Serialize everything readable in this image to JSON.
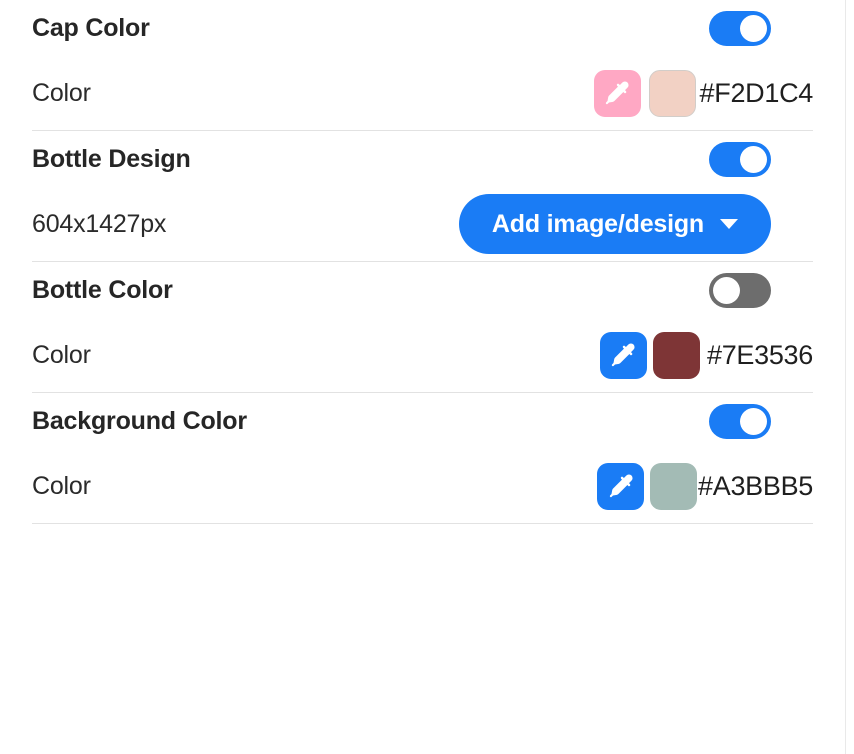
{
  "panel": {
    "sections": [
      {
        "id": "cap-color",
        "title": "Cap Color",
        "toggle_state": "on",
        "control_type": "color",
        "label": "Color",
        "eyedropper_bg": "#FFA8C4",
        "eyedropper_icon": "eyedropper-icon",
        "swatch_color": "#F2D1C4",
        "swatch_bordered": true,
        "hex": "#F2D1C4"
      },
      {
        "id": "bottle-design",
        "title": "Bottle Design",
        "toggle_state": "on",
        "control_type": "design",
        "label": "604x1427px",
        "button_label": "Add image/design",
        "button_bg": "#1A7CF5",
        "caret_icon": "chevron-down-icon"
      },
      {
        "id": "bottle-color",
        "title": "Bottle Color",
        "toggle_state": "off",
        "control_type": "color",
        "label": "Color",
        "eyedropper_bg": "#1A7CF5",
        "eyedropper_icon": "eyedropper-icon",
        "swatch_color": "#7E3536",
        "swatch_bordered": false,
        "hex": "#7E3536"
      },
      {
        "id": "background-color",
        "title": "Background Color",
        "toggle_state": "on",
        "control_type": "color",
        "label": "Color",
        "eyedropper_bg": "#1A7CF5",
        "eyedropper_icon": "eyedropper-icon",
        "swatch_color": "#A3BBB5",
        "swatch_bordered": false,
        "hex": "#A3BBB5"
      }
    ],
    "colors": {
      "toggle_on": "#1A7CF5",
      "toggle_off": "#6D6D6D",
      "divider": "#E2E2E2",
      "heading_text": "#262626"
    }
  }
}
